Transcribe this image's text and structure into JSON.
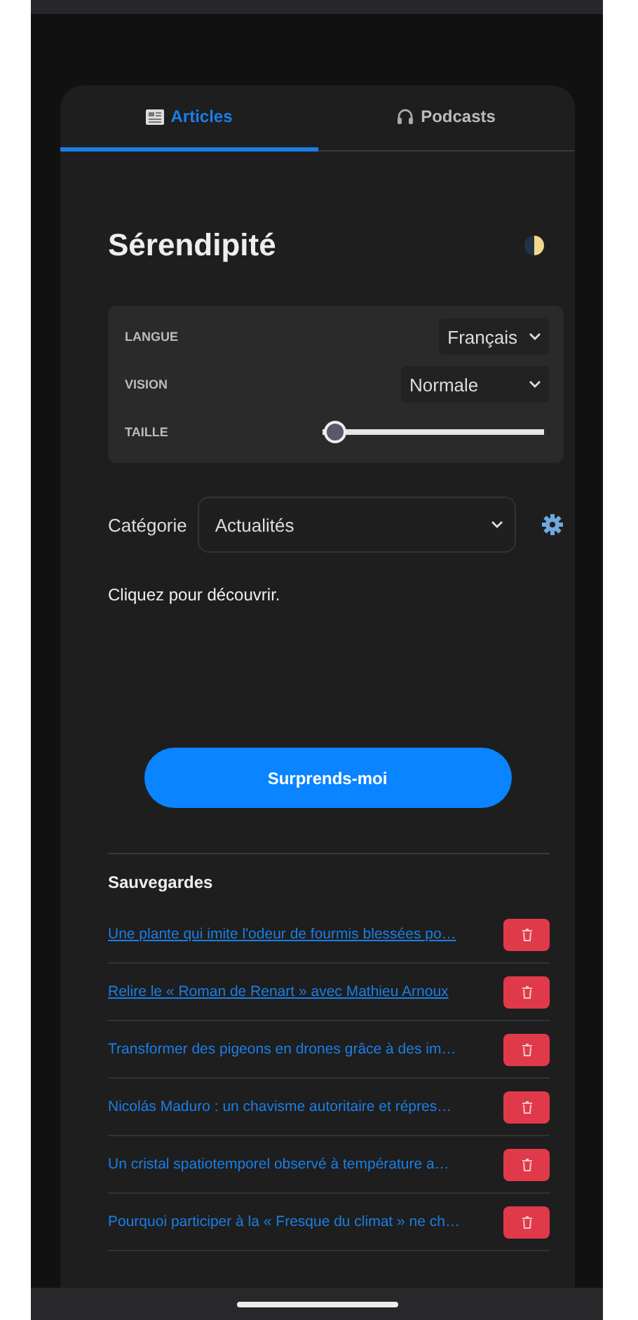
{
  "tabs": [
    {
      "label": "Articles",
      "selected": true
    },
    {
      "label": "Podcasts",
      "selected": false
    }
  ],
  "title": "Sérendipité",
  "settings": {
    "language": {
      "label": "LANGUE",
      "value": "Français"
    },
    "vision": {
      "label": "VISION",
      "value": "Normale"
    },
    "size": {
      "label": "TAILLE",
      "level": 0.03
    }
  },
  "category": {
    "label": "Catégorie",
    "value": "Actualités"
  },
  "hint": "Cliquez pour découvrir.",
  "surprise_button": "Surprends-moi",
  "saved": {
    "title": "Sauvegardes",
    "items": [
      {
        "title": "Une plante qui imite l'odeur de fourmis blessées po…",
        "visited": true
      },
      {
        "title": "Relire le « Roman de Renart » avec Mathieu Arnoux",
        "visited": true
      },
      {
        "title": "Transformer des pigeons en drones grâce à des im…",
        "visited": false
      },
      {
        "title": "Nicolás Maduro : un chavisme autoritaire et répres…",
        "visited": false
      },
      {
        "title": "Un cristal spatiotemporel observé à température a…",
        "visited": false
      },
      {
        "title": "Pourquoi participer à la « Fresque du climat » ne ch…",
        "visited": false
      }
    ]
  }
}
